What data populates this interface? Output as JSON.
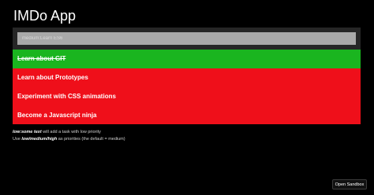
{
  "app": {
    "title": "IMDo App"
  },
  "input": {
    "placeholder": "medium:Learn ES6",
    "value": ""
  },
  "tasks": [
    {
      "label": "Learn about GIT",
      "done": true,
      "color": "#1ab51f"
    },
    {
      "label": "Learn about Prototypes",
      "done": false,
      "color": "#ef0f1a"
    },
    {
      "label": "Experiment with CSS animations",
      "done": false,
      "color": "#ef0f1a"
    },
    {
      "label": "Become a Javascript ninja",
      "done": false,
      "color": "#ef0f1a"
    }
  ],
  "help": {
    "line1_keyword": "low:some text",
    "line1_text": " will add a task with low priority",
    "line2_prefix": "Use ",
    "line2_keyword": "low/medium/high",
    "line2_text": " as priorities (the default = medium)"
  },
  "footer": {
    "sandbox_label": "Open Sandbox"
  },
  "colors": {
    "background": "#000000",
    "panel": "#262626",
    "input": "#a9a9a9",
    "done": "#1ab51f",
    "pending": "#ef0f1a"
  }
}
